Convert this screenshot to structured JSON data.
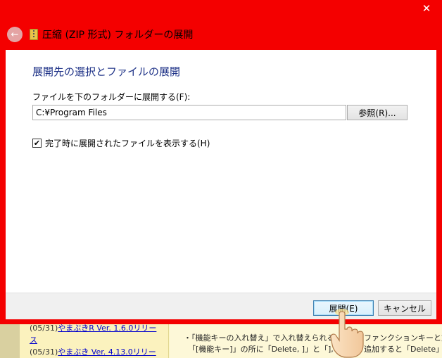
{
  "window": {
    "title": "圧縮 (ZIP 形式) フォルダーの展開",
    "close_glyph": "✕",
    "back_glyph": "←"
  },
  "dialog": {
    "heading": "展開先の選択とファイルの展開",
    "field_label": "ファイルを下のフォルダーに展開する(F):",
    "path_value": "C:¥Program Files",
    "browse_label": "参照(R)...",
    "checkbox_checked": true,
    "checkbox_label": "完了時に展開されたファイルを表示する(H)",
    "extract_label": "展開(E)",
    "cancel_label": "キャンセル"
  },
  "background": {
    "row1_date": "(05/31)",
    "row1_link": "やまぶきR Ver. 1.6.0リリー",
    "row2_date": "(05/31)",
    "row2_link": "やまぶき Ver. 4.13.0リリー",
    "row1_wrap": "ス",
    "text1": "・「機能キーの入れ替え」で入れ替えられる",
    "text1b": "ファンクションキーと文",
    "text2": "「[機能キー]」の所に「Delete, ]」と「], Dele",
    "text2b": "追加すると「Delete」キー"
  },
  "colors": {
    "frame": "#f40000",
    "heading": "#1e3287",
    "link": "#0000cc"
  }
}
